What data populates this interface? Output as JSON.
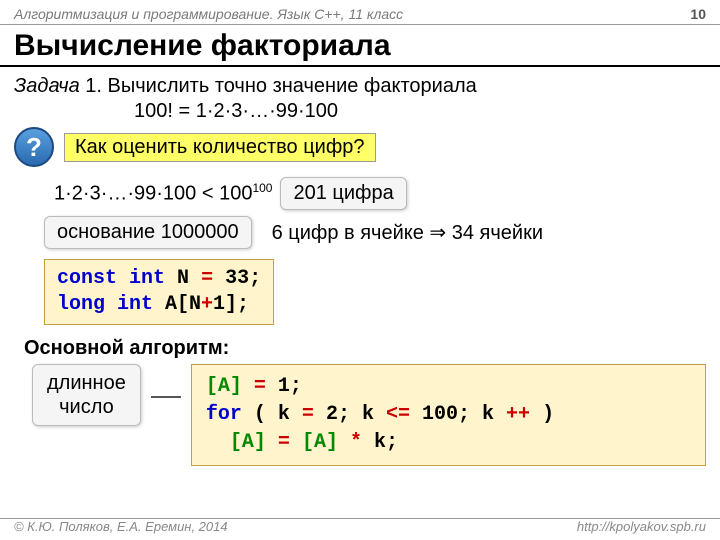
{
  "header": {
    "course": "Алгоритмизация и программирование. Язык C++, 11 класс",
    "page": "10"
  },
  "title": "Вычисление факториала",
  "task": {
    "label": "Задача",
    "num": "1.",
    "text": "Вычислить точно значение факториала",
    "formula": "100! = 1·2·3·…·99·100"
  },
  "question": {
    "mark": "?",
    "text": "Как оценить количество цифр?"
  },
  "estimate": {
    "inequality": "1·2·3·…·99·100  <  100",
    "exp": "100",
    "digits": "201 цифра",
    "base": "основание 1000000",
    "cells": "6 цифр в ячейке ",
    "arrow": "⇒",
    "cells2": " 34 ячейки"
  },
  "decl": {
    "l1a": "const int",
    "l1b": " N",
    "l1c": "=",
    "l1d": "33;",
    "l2a": "long int",
    "l2b": " A[N",
    "l2c": "+",
    "l2d": "1];"
  },
  "algo": {
    "title": "Основной алгоритм:",
    "long_num1": "длинное",
    "long_num2": "число",
    "c1a": "[A]",
    "c1b": "=",
    "c1c": "1;",
    "c2a": "for",
    "c2b": "( k",
    "c2c": "=",
    "c2d": "2; k",
    "c2e": "<=",
    "c2f": "100; k",
    "c2g": "++",
    "c2h": " )",
    "c3a": "[A]",
    "c3b": "=",
    "c3c": "[A]",
    "c3d": "*",
    "c3e": "k;"
  },
  "footer": {
    "copyright": "© К.Ю. Поляков, Е.А. Еремин, 2014",
    "url": "http://kpolyakov.spb.ru"
  }
}
